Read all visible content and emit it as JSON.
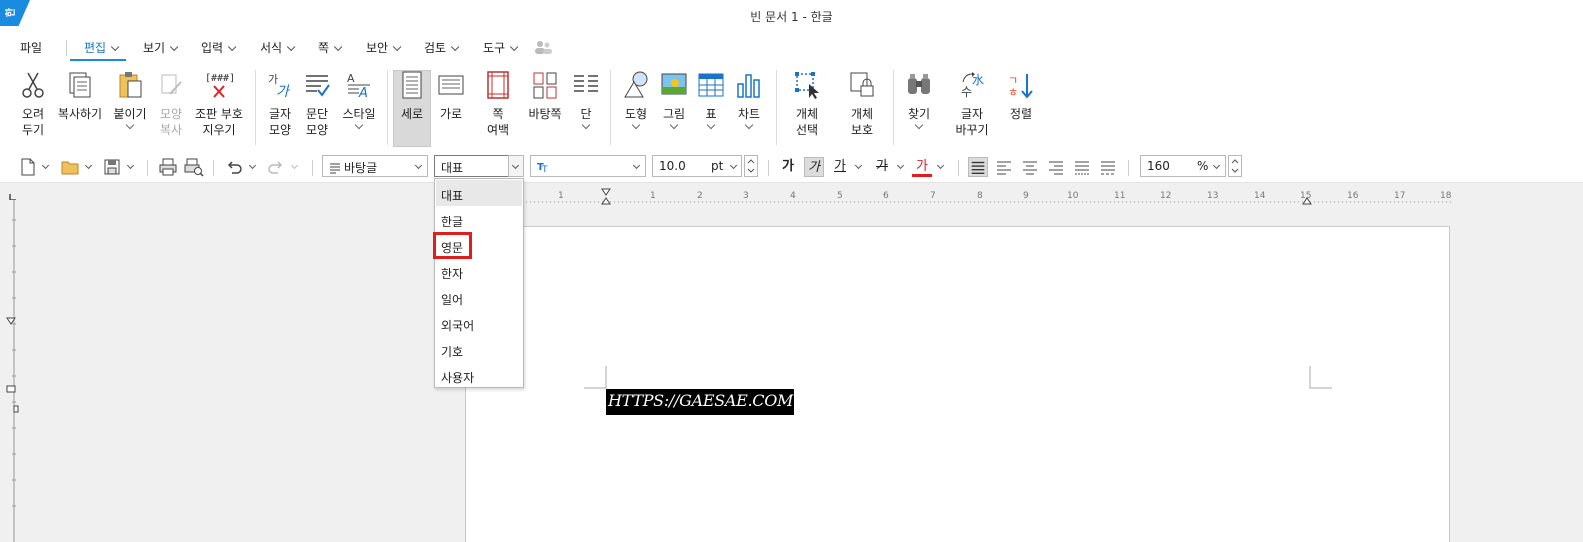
{
  "window": {
    "title": "빈 문서 1 - 한글",
    "logo": "한"
  },
  "menu": {
    "items": [
      "파일",
      "편집",
      "보기",
      "입력",
      "서식",
      "쪽",
      "보안",
      "검토",
      "도구"
    ],
    "active": "편집"
  },
  "ribbon": {
    "buttons": [
      {
        "line1": "오려",
        "line2": "두기",
        "icon": "scissors-icon"
      },
      {
        "line1": "복사하기",
        "line2": "",
        "icon": "copy-icon"
      },
      {
        "line1": "붙이기",
        "line2": "",
        "icon": "paste-icon"
      },
      {
        "line1": "모양",
        "line2": "복사",
        "icon": "format-painter-icon"
      },
      {
        "line1": "조판 부호",
        "line2": "지우기",
        "icon": "clear-codes-icon"
      },
      {
        "line1": "글자",
        "line2": "모양",
        "icon": "char-shape-icon"
      },
      {
        "line1": "문단",
        "line2": "모양",
        "icon": "para-shape-icon"
      },
      {
        "line1": "스타일",
        "line2": "",
        "icon": "style-icon"
      },
      {
        "line1": "세로",
        "line2": "",
        "icon": "portrait-icon"
      },
      {
        "line1": "가로",
        "line2": "",
        "icon": "landscape-icon"
      },
      {
        "line1": "쪽",
        "line2": "여백",
        "icon": "page-margin-icon"
      },
      {
        "line1": "바탕쪽",
        "line2": "",
        "icon": "master-page-icon"
      },
      {
        "line1": "단",
        "line2": "",
        "icon": "columns-icon"
      },
      {
        "line1": "도형",
        "line2": "",
        "icon": "shape-icon"
      },
      {
        "line1": "그림",
        "line2": "",
        "icon": "picture-icon"
      },
      {
        "line1": "표",
        "line2": "",
        "icon": "table-icon"
      },
      {
        "line1": "차트",
        "line2": "",
        "icon": "chart-icon"
      },
      {
        "line1": "개체",
        "line2": "선택",
        "icon": "object-select-icon"
      },
      {
        "line1": "개체",
        "line2": "보호",
        "icon": "object-protect-icon"
      },
      {
        "line1": "찾기",
        "line2": "",
        "icon": "binoculars-icon"
      },
      {
        "line1": "글자",
        "line2": "바꾸기",
        "icon": "char-convert-icon"
      },
      {
        "line1": "정렬",
        "line2": "",
        "icon": "sort-icon"
      }
    ]
  },
  "toolbar": {
    "style_value": "바탕글",
    "lang_value": "대표",
    "font_value": "",
    "size_value": "10.0",
    "size_unit": "pt",
    "zoom_value": "160",
    "zoom_unit": "%",
    "bold_glyph": "가",
    "italic_glyph": "가",
    "underline_glyph": "가",
    "strike_glyph": "가",
    "color_glyph": "가"
  },
  "dropdown": {
    "items": [
      "대표",
      "한글",
      "영문",
      "한자",
      "일어",
      "외국어",
      "기호",
      "사용자"
    ],
    "hovered": "대표",
    "highlighted": "영문"
  },
  "ruler": {
    "ticks": [
      "2",
      "1",
      "1",
      "2",
      "3",
      "4",
      "5",
      "6",
      "7",
      "8",
      "9",
      "10",
      "11",
      "12",
      "13",
      "14",
      "15",
      "16",
      "17",
      "18"
    ]
  },
  "document": {
    "text": "HTTPS://GAESAE.COM"
  },
  "colors": {
    "accent": "#1a8ce0",
    "highlight_box": "#e01e1e",
    "text_bg": "#000000"
  }
}
